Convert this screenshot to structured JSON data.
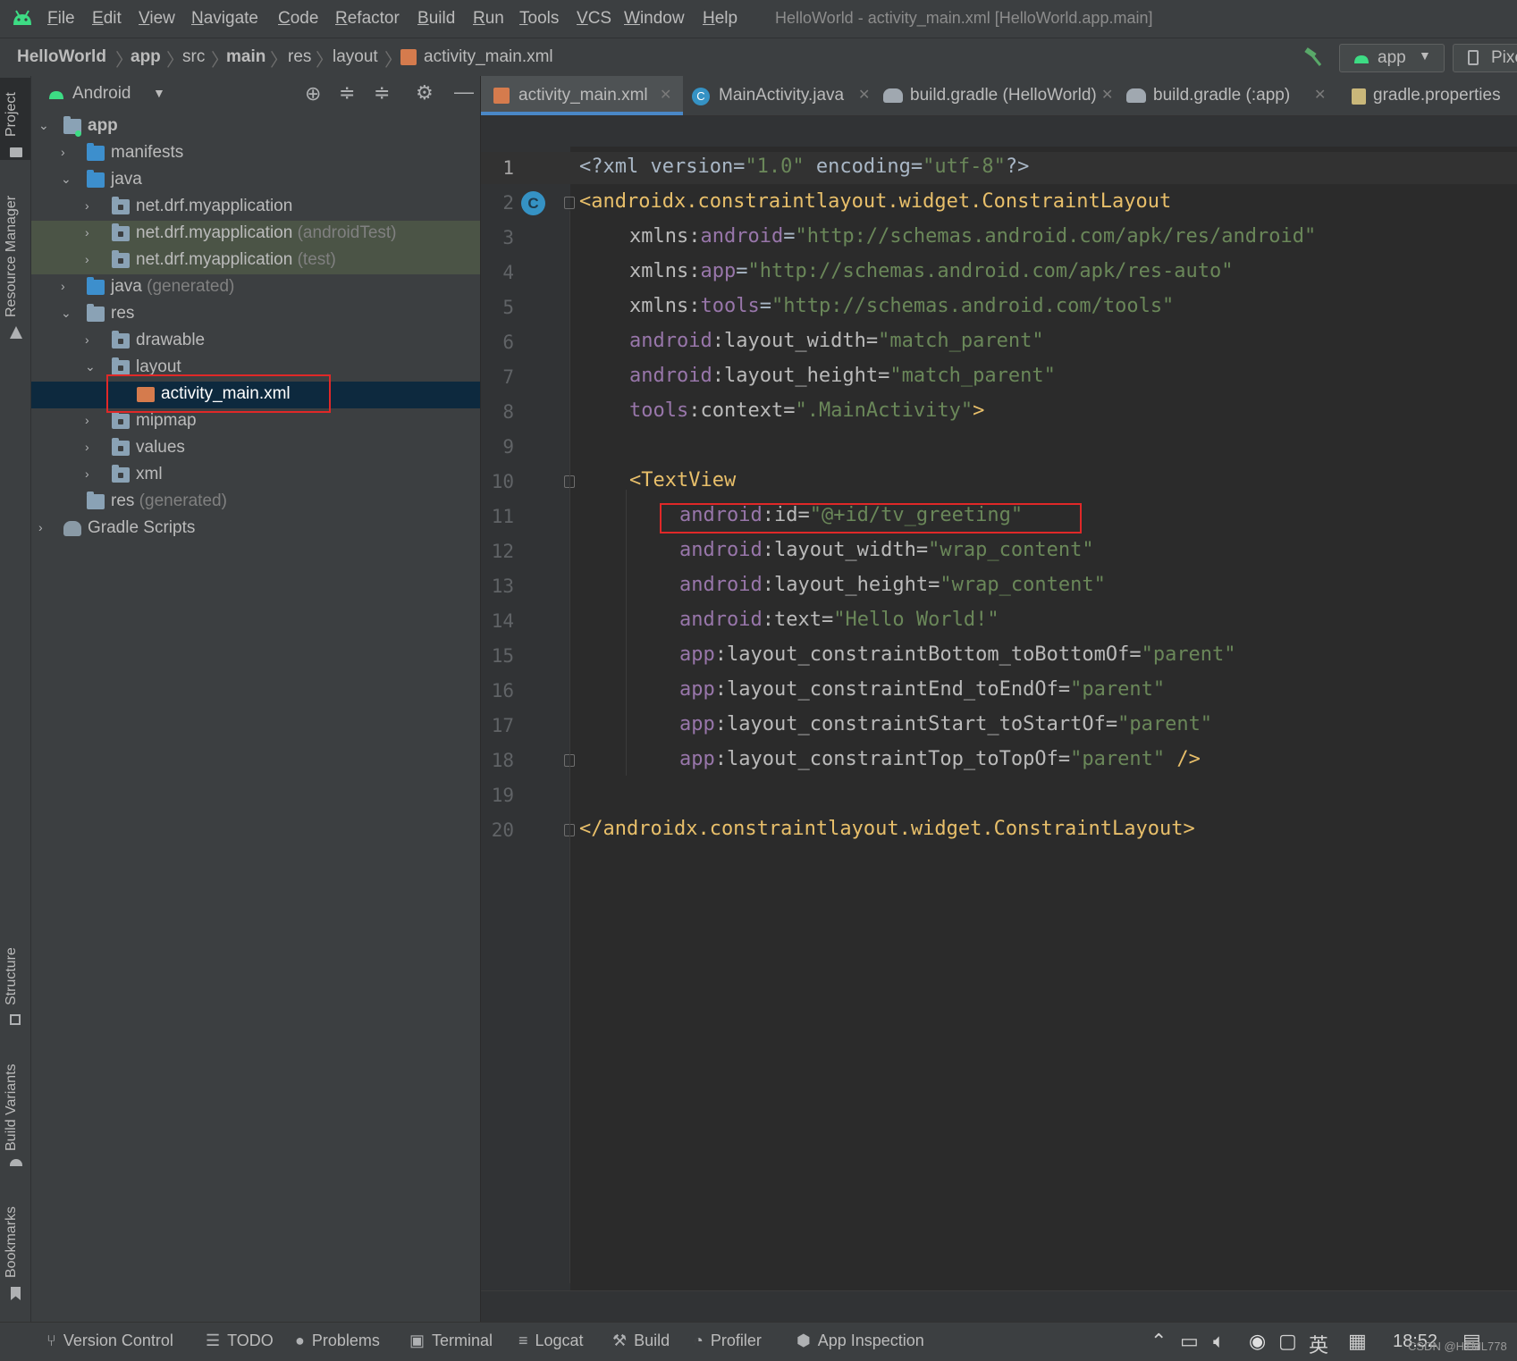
{
  "menu": [
    "File",
    "Edit",
    "View",
    "Navigate",
    "Code",
    "Refactor",
    "Build",
    "Run",
    "Tools",
    "VCS",
    "Window",
    "Help"
  ],
  "window_title": "HelloWorld - activity_main.xml [HelloWorld.app.main]",
  "breadcrumb": [
    "HelloWorld",
    "app",
    "src",
    "main",
    "res",
    "layout",
    "activity_main.xml"
  ],
  "toolbar": {
    "run_config": "app",
    "device": "Pixel"
  },
  "left_strip": {
    "project": "Project",
    "resource_manager": "Resource Manager",
    "structure": "Structure",
    "build_variants": "Build Variants",
    "bookmarks": "Bookmarks"
  },
  "panel": {
    "view_mode": "Android"
  },
  "tree": [
    {
      "label": "app",
      "suffix": ""
    },
    {
      "label": "manifests",
      "suffix": ""
    },
    {
      "label": "java",
      "suffix": ""
    },
    {
      "label": "net.drf.myapplication",
      "suffix": ""
    },
    {
      "label": "net.drf.myapplication",
      "suffix": " (androidTest)"
    },
    {
      "label": "net.drf.myapplication",
      "suffix": " (test)"
    },
    {
      "label": "java",
      "suffix": " (generated)"
    },
    {
      "label": "res",
      "suffix": ""
    },
    {
      "label": "drawable",
      "suffix": ""
    },
    {
      "label": "layout",
      "suffix": ""
    },
    {
      "label": "activity_main.xml",
      "suffix": ""
    },
    {
      "label": "mipmap",
      "suffix": ""
    },
    {
      "label": "values",
      "suffix": ""
    },
    {
      "label": "xml",
      "suffix": ""
    },
    {
      "label": "res",
      "suffix": " (generated)"
    },
    {
      "label": "Gradle Scripts",
      "suffix": ""
    }
  ],
  "tabs": [
    "activity_main.xml",
    "MainActivity.java",
    "build.gradle (HelloWorld)",
    "build.gradle (:app)",
    "gradle.properties"
  ],
  "gutter_badge": "C",
  "code": {
    "l1": [
      "<?xml version=",
      "\"1.0\"",
      " encoding=",
      "\"utf-8\"",
      "?>"
    ],
    "l2": "<androidx.constraintlayout.widget.ConstraintLayout",
    "l3": [
      "xmlns:",
      "android",
      "=",
      "\"http://schemas.android.com/apk/res/android\""
    ],
    "l4": [
      "xmlns:",
      "app",
      "=",
      "\"http://schemas.android.com/apk/res-auto\""
    ],
    "l5": [
      "xmlns:",
      "tools",
      "=",
      "\"http://schemas.android.com/tools\""
    ],
    "l6": [
      "android",
      ":layout_width=",
      "\"match_parent\""
    ],
    "l7": [
      "android",
      ":layout_height=",
      "\"match_parent\""
    ],
    "l8": [
      "tools",
      ":context=",
      "\".MainActivity\"",
      ">"
    ],
    "l10": "<TextView",
    "l11": [
      "android",
      ":id=",
      "\"@+id/tv_greeting\""
    ],
    "l12": [
      "android",
      ":layout_width=",
      "\"wrap_content\""
    ],
    "l13": [
      "android",
      ":layout_height=",
      "\"wrap_content\""
    ],
    "l14": [
      "android",
      ":text=",
      "\"Hello World!\""
    ],
    "l15": [
      "app",
      ":layout_constraintBottom_toBottomOf=",
      "\"parent\""
    ],
    "l16": [
      "app",
      ":layout_constraintEnd_toEndOf=",
      "\"parent\""
    ],
    "l17": [
      "app",
      ":layout_constraintStart_toStartOf=",
      "\"parent\""
    ],
    "l18": [
      "app",
      ":layout_constraintTop_toTopOf=",
      "\"parent\"",
      " />"
    ],
    "l20": "</androidx.constraintlayout.widget.ConstraintLayout>"
  },
  "bottom_tools": [
    "Version Control",
    "TODO",
    "Problems",
    "Terminal",
    "Logcat",
    "Build",
    "Profiler",
    "App Inspection"
  ],
  "tray": {
    "time": "18:52",
    "ime": "英",
    "watermark": "CSDN @HTML778"
  }
}
